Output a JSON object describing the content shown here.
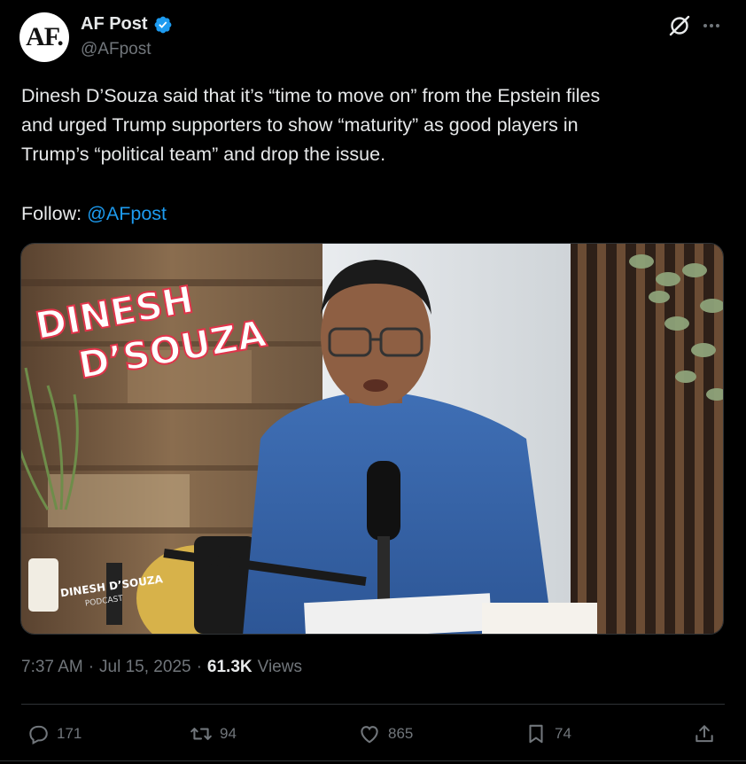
{
  "author": {
    "avatar_text": "AF.",
    "name": "AF Post",
    "handle": "@AFpost"
  },
  "tweet": {
    "text": "Dinesh D’Souza said that it’s “time to move on” from the Epstein files\nand urged Trump supporters to show “maturity” as good players in\nTrump’s “political team” and drop the issue.",
    "follow_label": "Follow: ",
    "follow_mention": "@AFpost"
  },
  "media": {
    "sign_line1": "DINESH",
    "sign_line2": "D’SOUZA",
    "podcast_line1": "DINESH D’SOUZA",
    "podcast_line2": "PODCAST"
  },
  "meta": {
    "time": "7:37 AM",
    "sep1": "·",
    "date": "Jul 15, 2025",
    "sep2": "·",
    "views_count": "61.3K",
    "views_label": "Views"
  },
  "actions": {
    "replies": "171",
    "reposts": "94",
    "likes": "865",
    "bookmarks": "74"
  },
  "colors": {
    "background": "#000000",
    "text": "#e7e9ea",
    "secondary": "#71767b",
    "accent": "#1d9bf0",
    "border": "#2f3336"
  },
  "icons": [
    "verified-badge-icon",
    "grok-icon",
    "more-icon",
    "reply-icon",
    "repost-icon",
    "like-icon",
    "bookmark-icon",
    "share-icon"
  ]
}
